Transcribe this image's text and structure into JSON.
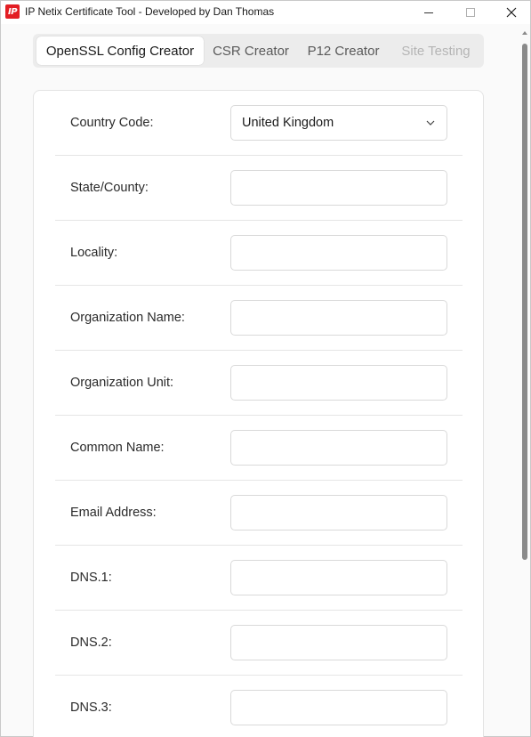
{
  "window": {
    "title": "IP Netix Certificate Tool - Developed by Dan Thomas",
    "icon_text": "IP",
    "icon_color": "#e31e24"
  },
  "tabs": [
    {
      "label": "OpenSSL Config Creator",
      "state": "active"
    },
    {
      "label": "CSR Creator",
      "state": "normal"
    },
    {
      "label": "P12 Creator",
      "state": "normal"
    },
    {
      "label": "Site Testing",
      "state": "disabled"
    }
  ],
  "form": {
    "rows": [
      {
        "label": "Country Code:",
        "type": "select",
        "value": "United Kingdom"
      },
      {
        "label": "State/County:",
        "type": "text",
        "value": ""
      },
      {
        "label": "Locality:",
        "type": "text",
        "value": ""
      },
      {
        "label": "Organization Name:",
        "type": "text",
        "value": ""
      },
      {
        "label": "Organization Unit:",
        "type": "text",
        "value": ""
      },
      {
        "label": "Common Name:",
        "type": "text",
        "value": ""
      },
      {
        "label": "Email Address:",
        "type": "text",
        "value": ""
      },
      {
        "label": "DNS.1:",
        "type": "text",
        "value": ""
      },
      {
        "label": "DNS.2:",
        "type": "text",
        "value": ""
      },
      {
        "label": "DNS.3:",
        "type": "text",
        "value": ""
      }
    ]
  },
  "icons": {
    "minimize": "minimize-icon",
    "maximize": "maximize-icon",
    "close": "close-icon",
    "dropdown": "chevron-down-icon"
  }
}
